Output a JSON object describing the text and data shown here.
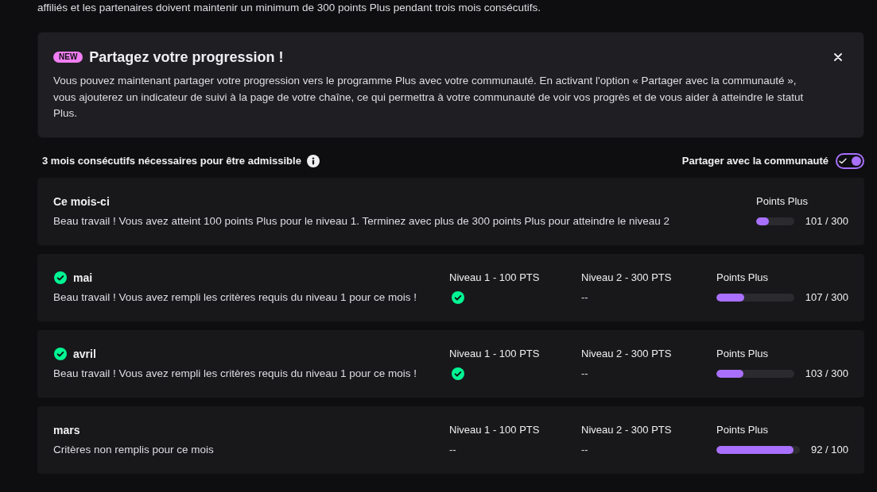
{
  "intro": {
    "text": "affiliés et les partenaires doivent maintenir un minimum de 300 points Plus pendant trois mois consécutifs."
  },
  "announcement": {
    "badge": "NEW",
    "title": "Partagez votre progression !",
    "body": "Vous pouvez maintenant partager votre progression vers le programme Plus avec votre communauté. En activant l'option « Partager avec la communauté », vous ajouterez un indicateur de suivi à la page de votre chaîne, ce qui permettra à votre communauté de voir vos progrès et de vous aider à atteindre le statut Plus."
  },
  "requirement": {
    "label": "3 mois consécutifs nécessaires pour être admissible"
  },
  "share_toggle": {
    "label": "Partager avec la communauté",
    "on": true
  },
  "current_month": {
    "title": "Ce mois-ci",
    "message": "Beau travail ! Vous avez atteint 100 points Plus pour le niveau 1. Terminez avec plus de 300 points Plus pour atteindre le niveau 2",
    "points": {
      "label": "Points Plus",
      "level": 0.337,
      "reading": "101 / 300"
    }
  },
  "months": [
    {
      "title": "mai",
      "completed": true,
      "message": "Beau travail ! Vous avez rempli les critères requis du niveau 1 pour ce mois !",
      "levels": [
        {
          "label": "Niveau 1 - 100 PTS",
          "achieved": true
        },
        {
          "label": "Niveau 2 - 300 PTS",
          "achieved": false,
          "value": "--"
        }
      ],
      "points": {
        "label": "Points Plus",
        "level": 0.357,
        "reading": "107 / 300"
      }
    },
    {
      "title": "avril",
      "completed": true,
      "message": "Beau travail ! Vous avez rempli les critères requis du niveau 1 pour ce mois !",
      "levels": [
        {
          "label": "Niveau 1 - 100 PTS",
          "achieved": true
        },
        {
          "label": "Niveau 2 - 300 PTS",
          "achieved": false,
          "value": "--"
        }
      ],
      "points": {
        "label": "Points Plus",
        "level": 0.343,
        "reading": "103 / 300"
      }
    },
    {
      "title": "mars",
      "completed": false,
      "message": "Critères non remplis pour ce mois",
      "levels": [
        {
          "label": "Niveau 1 - 100 PTS",
          "achieved": false,
          "value": "--"
        },
        {
          "label": "Niveau 2 - 300 PTS",
          "achieved": false,
          "value": "--"
        }
      ],
      "points": {
        "label": "Points Plus",
        "level": 0.92,
        "reading": "92 / 100"
      }
    }
  ]
}
